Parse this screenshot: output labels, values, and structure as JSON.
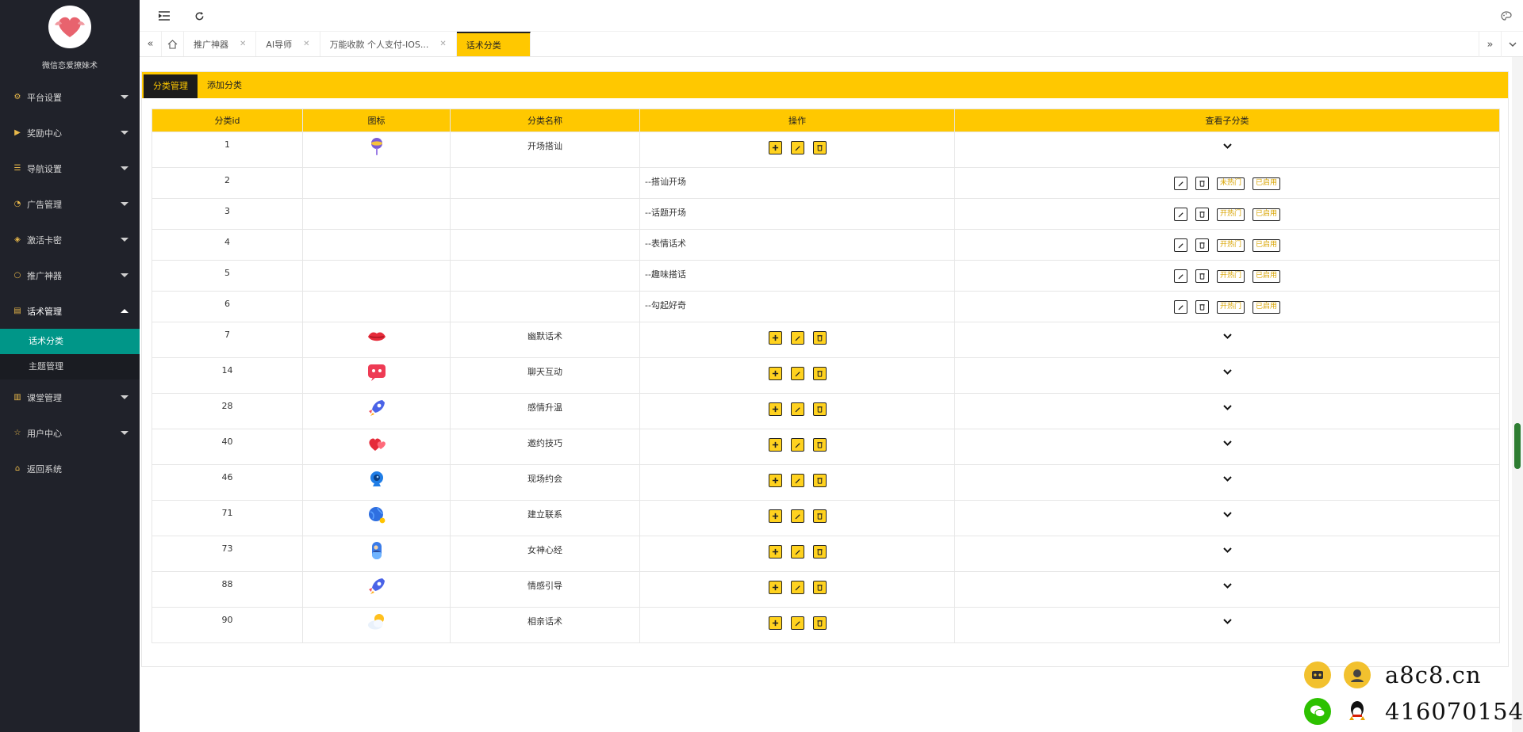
{
  "sidebar": {
    "site_name": "微信恋爱撩妹术",
    "menu": [
      {
        "label": "平台设置",
        "icon": "gear-icon"
      },
      {
        "label": "奖励中心",
        "icon": "play-icon"
      },
      {
        "label": "导航设置",
        "icon": "list-icon"
      },
      {
        "label": "广告管理",
        "icon": "dashboard-icon"
      },
      {
        "label": "激活卡密",
        "icon": "cube-icon"
      },
      {
        "label": "推广神器",
        "icon": "chat-icon"
      },
      {
        "label": "话术管理",
        "icon": "doc-icon"
      },
      {
        "label": "课堂管理",
        "icon": "book-icon"
      },
      {
        "label": "用户中心",
        "icon": "star-icon"
      },
      {
        "label": "返回系统",
        "icon": "home-icon"
      }
    ],
    "submenu": [
      {
        "label": "话术分类"
      },
      {
        "label": "主题管理"
      }
    ]
  },
  "tabs": [
    {
      "label": "推广神器"
    },
    {
      "label": "AI导师"
    },
    {
      "label": "万能收款 个人支付-IOS..."
    },
    {
      "label": "话术分类"
    }
  ],
  "card_tabs": [
    {
      "label": "分类管理"
    },
    {
      "label": "添加分类"
    }
  ],
  "table": {
    "headers": [
      "分类id",
      "图标",
      "分类名称",
      "操作",
      "查看子分类"
    ],
    "rows": [
      {
        "id": "1",
        "name": "开场搭讪",
        "icon": "lollipop-icon"
      },
      {
        "id": "2",
        "child_name": "--搭讪开场",
        "hot": "未热门",
        "status": "已启用"
      },
      {
        "id": "3",
        "child_name": "--话题开场",
        "hot": "开热门",
        "status": "已启用"
      },
      {
        "id": "4",
        "child_name": "--表情话术",
        "hot": "开热门",
        "status": "已启用"
      },
      {
        "id": "5",
        "child_name": "--趣味搭话",
        "hot": "开热门",
        "status": "已启用"
      },
      {
        "id": "6",
        "child_name": "--勾起好奇",
        "hot": "开热门",
        "status": "已启用"
      },
      {
        "id": "7",
        "name": "幽默话术",
        "icon": "lips-icon"
      },
      {
        "id": "14",
        "name": "聊天互动",
        "icon": "chat-bubble-icon"
      },
      {
        "id": "28",
        "name": "感情升温",
        "icon": "rocket-icon"
      },
      {
        "id": "40",
        "name": "邀约技巧",
        "icon": "hearts-icon"
      },
      {
        "id": "46",
        "name": "现场约会",
        "icon": "webcam-icon"
      },
      {
        "id": "71",
        "name": "建立联系",
        "icon": "globe-icon"
      },
      {
        "id": "73",
        "name": "女神心经",
        "icon": "capsule-icon"
      },
      {
        "id": "88",
        "name": "情感引导",
        "icon": "rocket-icon"
      },
      {
        "id": "90",
        "name": "相亲话术",
        "icon": "sun-cloud-icon"
      }
    ]
  },
  "watermark": {
    "domain": "a8c8.cn",
    "qq": "416070154"
  },
  "colors": {
    "sidebar_bg": "#20222a",
    "accent_yellow": "#ffc800",
    "selected_teal": "#009688"
  }
}
